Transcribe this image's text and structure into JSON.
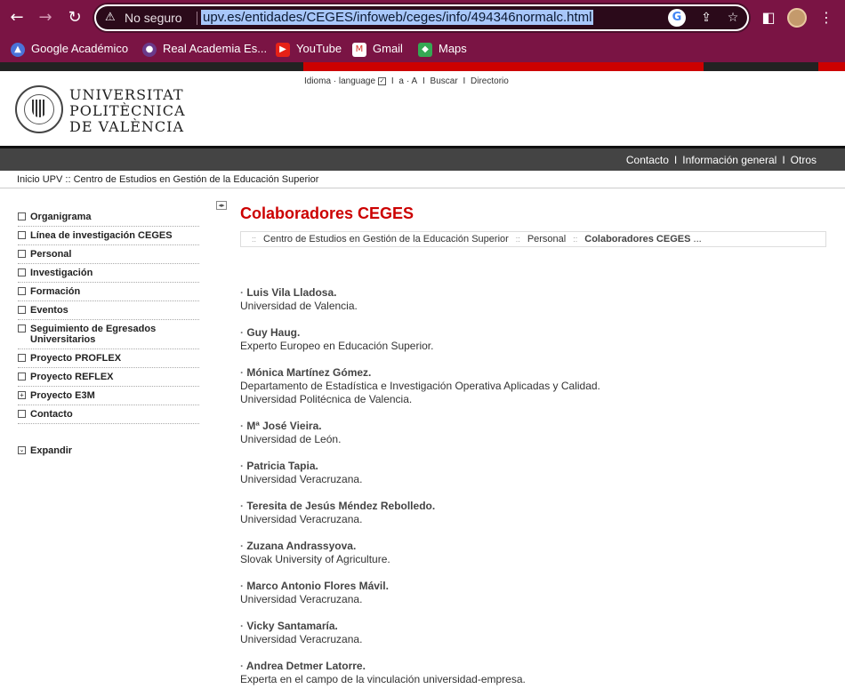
{
  "browser": {
    "not_secure": "No seguro",
    "url": "upv.es/entidades/CEGES/infoweb/ceges/info/494346normalc.html",
    "bookmarks": [
      "Google Académico",
      "Real Academia Es...",
      "YouTube",
      "Gmail",
      "Maps"
    ]
  },
  "header": {
    "uni_line1": "UNIVERSITAT",
    "uni_line2": "POLITÈCNICA",
    "uni_line3": "DE VALÈNCIA",
    "idioma": "Idioma · language",
    "small_a": "a",
    "big_a": "A",
    "buscar": "Buscar",
    "directorio": "Directorio",
    "sep": "I"
  },
  "graybar": {
    "contacto": "Contacto",
    "info_general": "Información general",
    "otros": "Otros",
    "sep": "I"
  },
  "breadcrumb_top": "Inicio UPV :: Centro de Estudios en Gestión de la Educación Superior",
  "leftnav": {
    "items": [
      {
        "label": "Organigrama",
        "box": ""
      },
      {
        "label": "Línea de investigación CEGES",
        "box": ""
      },
      {
        "label": "Personal",
        "box": ""
      },
      {
        "label": "Investigación",
        "box": ""
      },
      {
        "label": "Formación",
        "box": ""
      },
      {
        "label": "Eventos",
        "box": ""
      },
      {
        "label": "Seguimiento de Egresados Universitarios",
        "box": ""
      },
      {
        "label": "Proyecto PROFLEX",
        "box": ""
      },
      {
        "label": "Proyecto REFLEX",
        "box": ""
      },
      {
        "label": "Proyecto E3M",
        "box": "+"
      },
      {
        "label": "Contacto",
        "box": ""
      }
    ],
    "expand": "Expandir"
  },
  "main": {
    "title": "Colaboradores CEGES",
    "crumb": {
      "a": "Centro de Estudios en Gestión de la Educación Superior",
      "b": "Personal",
      "c": "Colaboradores CEGES",
      "ellipsis": "...",
      "sep": "::"
    },
    "people": [
      {
        "name": "Luis Vila Lladosa.",
        "lines": [
          "Universidad de Valencia."
        ]
      },
      {
        "name": "Guy Haug.",
        "lines": [
          "Experto Europeo en Educación Superior."
        ]
      },
      {
        "name": "Mónica Martínez Gómez.",
        "lines": [
          "Departamento de Estadística e Investigación Operativa Aplicadas y Calidad.",
          "Universidad Politécnica de Valencia."
        ]
      },
      {
        "name": "Mª José Vieira.",
        "lines": [
          "Universidad de León."
        ]
      },
      {
        "name": "Patricia Tapia.",
        "lines": [
          "Universidad Veracruzana."
        ]
      },
      {
        "name": "Teresita de Jesús Méndez Rebolledo.",
        "lines": [
          "Universidad Veracruzana."
        ]
      },
      {
        "name": "Zuzana Andrassyova.",
        "lines": [
          "Slovak University of Agriculture."
        ]
      },
      {
        "name": "Marco Antonio Flores Mávil.",
        "lines": [
          "Universidad Veracruzana."
        ]
      },
      {
        "name": "Vicky Santamaría.",
        "lines": [
          "Universidad Veracruzana."
        ]
      },
      {
        "name": "Andrea Detmer Latorre.",
        "lines": [
          "Experta en el campo de la vinculación universidad-empresa."
        ]
      }
    ]
  }
}
